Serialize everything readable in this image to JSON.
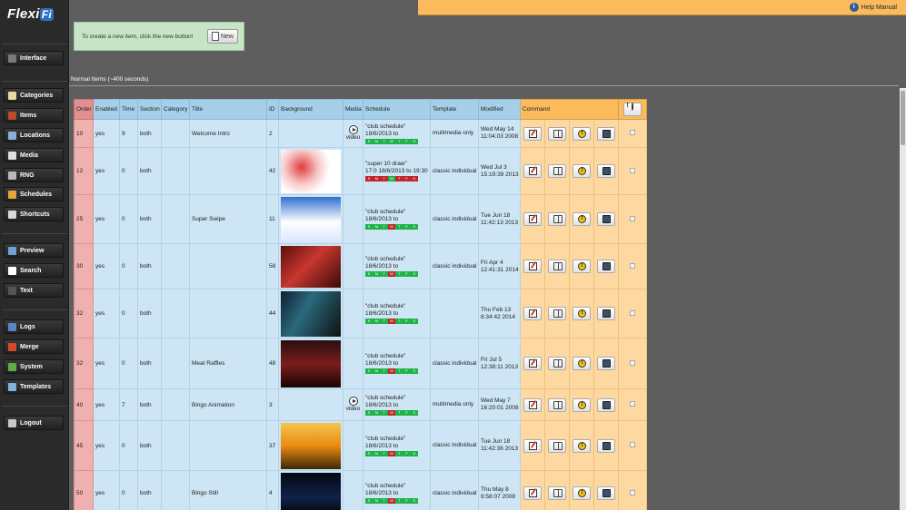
{
  "app": {
    "logo_text": "Flexi",
    "logo_accent": "Fi"
  },
  "header": {
    "help_label": "Help Manual"
  },
  "sidebar": {
    "items": [
      {
        "label": "Interface",
        "icon": "interface-icon",
        "color": "#7a7a7a"
      },
      {
        "label": "Categories",
        "icon": "categories-icon",
        "color": "#e8d9a0"
      },
      {
        "label": "Items",
        "icon": "items-icon",
        "color": "#c04a2a"
      },
      {
        "label": "Locations",
        "icon": "locations-icon",
        "color": "#8bb0d6"
      },
      {
        "label": "Media",
        "icon": "media-icon",
        "color": "#e0e0e0"
      },
      {
        "label": "RNG",
        "icon": "rng-icon",
        "color": "#b8b8b8"
      },
      {
        "label": "Schedules",
        "icon": "schedules-icon",
        "color": "#e8a33c"
      },
      {
        "label": "Shortcuts",
        "icon": "shortcuts-icon",
        "color": "#d9d9d9"
      },
      {
        "label": "Preview",
        "icon": "preview-icon",
        "color": "#6fa0d8"
      },
      {
        "label": "Search",
        "icon": "search-icon",
        "color": "#ffffff"
      },
      {
        "label": "Text",
        "icon": "text-icon",
        "color": "#555555"
      },
      {
        "label": "Logs",
        "icon": "logs-icon",
        "color": "#5a84c5"
      },
      {
        "label": "Merge",
        "icon": "merge-icon",
        "color": "#d44b2c"
      },
      {
        "label": "System",
        "icon": "system-icon",
        "color": "#5fae45"
      },
      {
        "label": "Templates",
        "icon": "templates-icon",
        "color": "#7fb4dd"
      },
      {
        "label": "Logout",
        "icon": "logout-icon",
        "color": "#c8c8c8"
      }
    ]
  },
  "notice": {
    "text": "To create a new item, click the new button!",
    "new_label": "New"
  },
  "section_label": "Normal Items (~400 seconds)",
  "table": {
    "headers": {
      "order": "Order",
      "enabled": "Enabled",
      "time": "Time",
      "section": "Section",
      "category": "Category",
      "title": "Title",
      "id": "ID",
      "background": "Background",
      "media": "Media",
      "schedule": "Schedule",
      "template": "Template",
      "modified": "Modified",
      "command": "Command"
    },
    "day_letters": [
      "S",
      "M",
      "T",
      "W",
      "T",
      "F",
      "S"
    ],
    "rows": [
      {
        "order": "10",
        "enabled": "yes",
        "time": "9",
        "section": "both",
        "category": "",
        "title": "Welcome Intro",
        "id": "2",
        "background": "",
        "media": "video",
        "schedule_name": "\"club schedule\"",
        "schedule_dates": "18/6/2013 to",
        "days": [
          1,
          1,
          1,
          1,
          1,
          1,
          1
        ],
        "template": "multimedia only",
        "modified_date": "Wed May 14",
        "modified_time": "11:04:03 2008"
      },
      {
        "order": "12",
        "enabled": "yes",
        "time": "0",
        "section": "both",
        "category": "",
        "title": "",
        "id": "42",
        "background": "th-blurred",
        "media": "",
        "schedule_name": "\"super 10 draw\"",
        "schedule_dates": "17:0 18/6/2013 to 19:30",
        "days": [
          0,
          0,
          0,
          1,
          0,
          0,
          0
        ],
        "template": "classic individual",
        "modified_date": "Wed Jul 3",
        "modified_time": "15:19:39 2013"
      },
      {
        "order": "25",
        "enabled": "yes",
        "time": "0",
        "section": "both",
        "category": "",
        "title": "Super Swipe",
        "id": "11",
        "background": "th-sky",
        "media": "",
        "schedule_name": "\"club schedule\"",
        "schedule_dates": "18/6/2013 to",
        "days": [
          1,
          1,
          1,
          0,
          1,
          1,
          1
        ],
        "template": "classic individual",
        "modified_date": "Tue Jun 18",
        "modified_time": "11:42:13 2013"
      },
      {
        "order": "30",
        "enabled": "yes",
        "time": "0",
        "section": "both",
        "category": "",
        "title": "",
        "id": "58",
        "background": "th-red",
        "media": "",
        "schedule_name": "\"club schedule\"",
        "schedule_dates": "18/6/2013 to",
        "days": [
          1,
          1,
          1,
          0,
          1,
          1,
          1
        ],
        "template": "classic individual",
        "modified_date": "Fri Apr 4",
        "modified_time": "12:41:31 2014"
      },
      {
        "order": "32",
        "enabled": "yes",
        "time": "0",
        "section": "both",
        "category": "",
        "title": "",
        "id": "44",
        "background": "th-dark",
        "media": "",
        "schedule_name": "\"club schedule\"",
        "schedule_dates": "18/6/2013 to",
        "days": [
          1,
          1,
          1,
          0,
          1,
          1,
          1
        ],
        "template": "",
        "modified_date": "Thu Feb 13",
        "modified_time": "8:34:42 2014"
      },
      {
        "order": "32",
        "enabled": "yes",
        "time": "0",
        "section": "both",
        "category": "",
        "title": "Meat Raffles",
        "id": "48",
        "background": "th-brown",
        "media": "",
        "schedule_name": "\"club schedule\"",
        "schedule_dates": "18/6/2013 to",
        "days": [
          1,
          1,
          1,
          0,
          1,
          1,
          1
        ],
        "template": "classic individual",
        "modified_date": "Fri Jul 5",
        "modified_time": "12:38:11 2013"
      },
      {
        "order": "40",
        "enabled": "yes",
        "time": "7",
        "section": "both",
        "category": "",
        "title": "Bingo Animation",
        "id": "3",
        "background": "",
        "media": "video",
        "schedule_name": "\"club schedule\"",
        "schedule_dates": "18/6/2013 to",
        "days": [
          1,
          1,
          1,
          0,
          1,
          1,
          1
        ],
        "template": "multimedia only",
        "modified_date": "Wed May 7",
        "modified_time": "16:20:01 2008"
      },
      {
        "order": "45",
        "enabled": "yes",
        "time": "0",
        "section": "both",
        "category": "",
        "title": "",
        "id": "37",
        "background": "th-beer",
        "media": "",
        "schedule_name": "\"club schedule\"",
        "schedule_dates": "18/6/2013 to",
        "days": [
          1,
          1,
          1,
          0,
          1,
          1,
          1
        ],
        "template": "classic individual",
        "modified_date": "Tue Jun 18",
        "modified_time": "11:42:36 2013"
      },
      {
        "order": "50",
        "enabled": "yes",
        "time": "0",
        "section": "both",
        "category": "",
        "title": "Bingo Still",
        "id": "4",
        "background": "th-bingo",
        "media": "",
        "schedule_name": "\"club schedule\"",
        "schedule_dates": "18/6/2013 to",
        "days": [
          1,
          1,
          1,
          0,
          1,
          1,
          1
        ],
        "template": "classic individual",
        "modified_date": "Thu May 8",
        "modified_time": "9:58:07 2008"
      }
    ]
  },
  "colors": {
    "order_header": "#e48f8f",
    "blue_header": "#a6d0ea",
    "command_header": "#fbbb5c",
    "day_on": "#1fb34a",
    "day_off": "#c0262c"
  }
}
